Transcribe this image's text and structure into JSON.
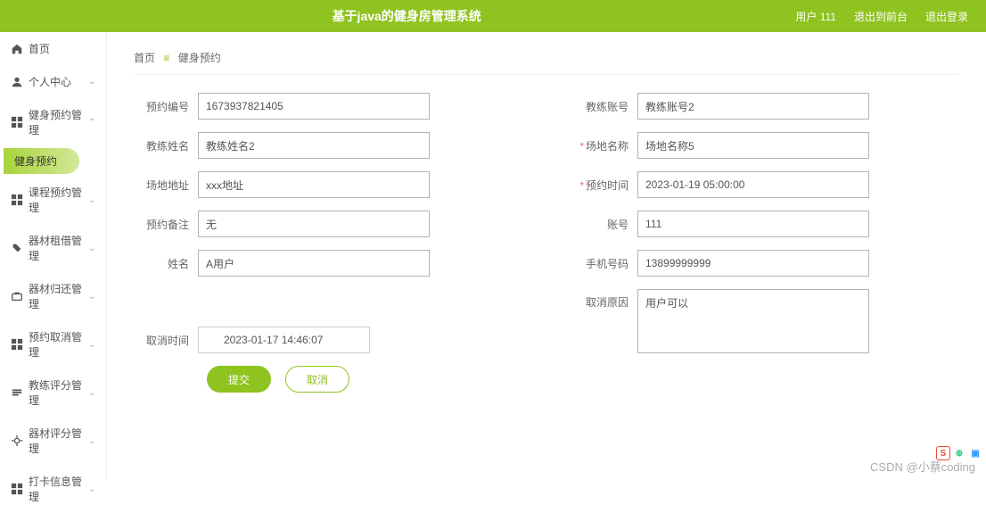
{
  "header": {
    "title": "基于java的健身房管理系统",
    "user_label": "用户 111",
    "back_label": "退出到前台",
    "logout_label": "退出登录"
  },
  "sidebar": {
    "items": [
      {
        "label": "首页",
        "icon": "home"
      },
      {
        "label": "个人中心",
        "icon": "user",
        "expandable": true
      },
      {
        "label": "健身预约管理",
        "icon": "grid",
        "expandable": true,
        "expanded": true
      },
      {
        "label": "课程预约管理",
        "icon": "grid",
        "expandable": true
      },
      {
        "label": "器材租借管理",
        "icon": "tool",
        "expandable": true
      },
      {
        "label": "器材归还管理",
        "icon": "return",
        "expandable": true
      },
      {
        "label": "预约取消管理",
        "icon": "grid",
        "expandable": true
      },
      {
        "label": "教练评分管理",
        "icon": "star",
        "expandable": true
      },
      {
        "label": "器材评分管理",
        "icon": "star",
        "expandable": true
      },
      {
        "label": "打卡信息管理",
        "icon": "card",
        "expandable": true
      }
    ],
    "submenu": "健身预约"
  },
  "breadcrumb": {
    "home": "首页",
    "current": "健身预约"
  },
  "form": {
    "left": [
      {
        "label": "预约编号",
        "value": "1673937821405"
      },
      {
        "label": "教练姓名",
        "value": "教练姓名2"
      },
      {
        "label": "场地地址",
        "value": "xxx地址"
      },
      {
        "label": "预约备注",
        "value": "无"
      },
      {
        "label": "姓名",
        "value": "A用户"
      }
    ],
    "right": [
      {
        "label": "教练账号",
        "value": "教练账号2"
      },
      {
        "label": "场地名称",
        "value": "场地名称5",
        "required": true
      },
      {
        "label": "预约时间",
        "value": "2023-01-19 05:00:00",
        "required": true
      },
      {
        "label": "账号",
        "value": "111"
      },
      {
        "label": "手机号码",
        "value": "13899999999"
      }
    ],
    "cancel_reason": {
      "label": "取消原因",
      "value": "用户可以"
    },
    "cancel_time": {
      "label": "取消时间",
      "value": "2023-01-17 14:46:07"
    },
    "submit_label": "提交",
    "cancel_label": "取消"
  },
  "watermark": "CSDN @小蔡coding"
}
